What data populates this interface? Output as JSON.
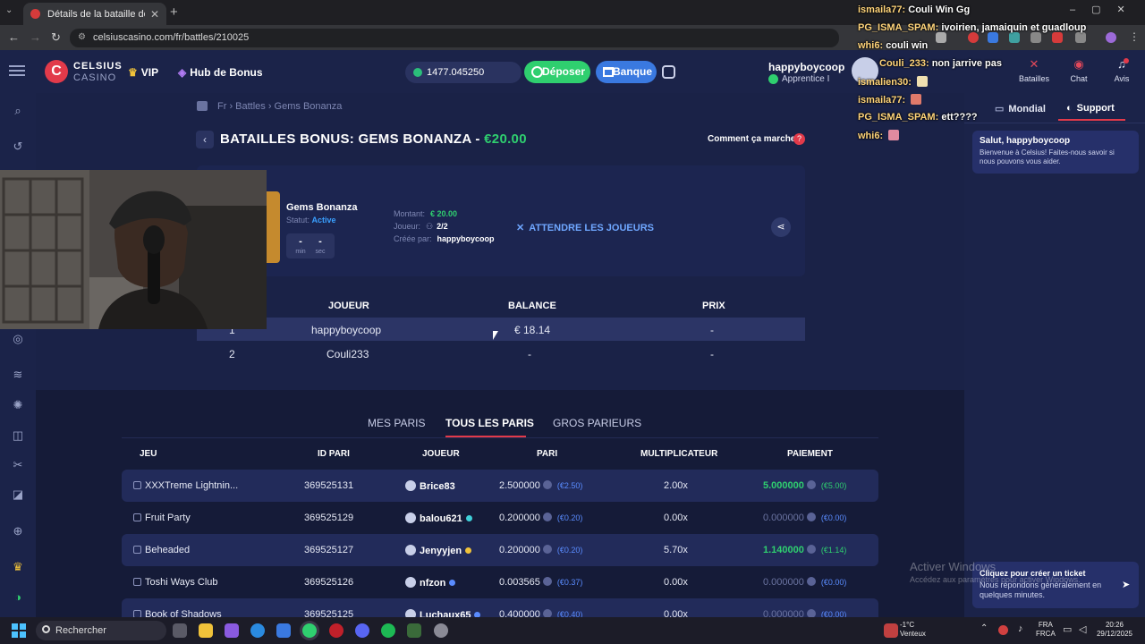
{
  "browser": {
    "tab_title": "Détails de la bataille de jeu Bat",
    "url": "celsiuscasino.com/fr/battles/210025"
  },
  "header": {
    "brand_line1": "CELSIUS",
    "brand_line2": "CASINO",
    "vip_label": "VIP",
    "hub_label": "Hub de Bonus",
    "balance": "1477.045250",
    "deposit_label": "Déposer",
    "bank_label": "Banque",
    "username": "happyboycoop",
    "rank": "Apprentice I",
    "buttons": [
      {
        "label": "Batailles",
        "icon": "swords-icon"
      },
      {
        "label": "Chat",
        "icon": "chat-icon"
      },
      {
        "label": "Avis",
        "icon": "bell-icon"
      }
    ]
  },
  "breadcrumb": {
    "text": "Fr  ›  Battles  ›  Gems Bonanza"
  },
  "page": {
    "title_prefix": "BATAILLES BONUS: GEMS BONANZA - ",
    "title_amount": "€20.00",
    "how_it_works": "Comment ça marche",
    "help_glyph": "?"
  },
  "battle": {
    "game_name": "Gems Bonanza",
    "status_label": "Statut:",
    "status_value": "Active",
    "timer": {
      "min_value": "-",
      "min_label": "min",
      "sec_value": "-",
      "sec_label": "sec"
    },
    "amount_label": "Montant:",
    "amount_value": "€ 20.00",
    "players_label": "Joueur:",
    "players_value": "2/2",
    "created_label": "Créée par:",
    "created_value": "happyboycoop",
    "waiting_label": "ATTENDRE LES JOUEURS"
  },
  "players_table": {
    "headers": [
      "JOUEUR",
      "BALANCE",
      "PRIX"
    ],
    "rows": [
      {
        "rank": "1",
        "player": "happyboycoop",
        "balance": "€ 18.14",
        "prize": "-"
      },
      {
        "rank": "2",
        "player": "Couli233",
        "balance": "-",
        "prize": "-"
      }
    ]
  },
  "bets": {
    "tabs": [
      "MES PARIS",
      "TOUS LES PARIS",
      "GROS PARIEURS"
    ],
    "active_tab": "TOUS LES PARIS",
    "headers": [
      "JEU",
      "ID PARI",
      "JOUEUR",
      "PARI",
      "MULTIPLICATEUR",
      "PAIEMENT"
    ],
    "rows": [
      {
        "game": "XXXTreme Lightnin...",
        "id": "369525131",
        "player": "Brice83",
        "tier": "",
        "bet": "2.500000",
        "bet_eur": "(€2.50)",
        "mult": "2.00x",
        "payout": "5.000000",
        "payout_eur": "(€5.00)",
        "win": true
      },
      {
        "game": "Fruit Party",
        "id": "369525129",
        "player": "balou621",
        "tier": "#3fd0d9",
        "bet": "0.200000",
        "bet_eur": "(€0.20)",
        "mult": "0.00x",
        "payout": "0.000000",
        "payout_eur": "(€0.00)",
        "win": false
      },
      {
        "game": "Beheaded",
        "id": "369525127",
        "player": "Jenyyjen",
        "tier": "#f0c23a",
        "bet": "0.200000",
        "bet_eur": "(€0.20)",
        "mult": "5.70x",
        "payout": "1.140000",
        "payout_eur": "(€1.14)",
        "win": true
      },
      {
        "game": "Toshi Ways Club",
        "id": "369525126",
        "player": "nfzon",
        "tier": "#5a8cff",
        "bet": "0.003565",
        "bet_eur": "(€0.37)",
        "mult": "0.00x",
        "payout": "0.000000",
        "payout_eur": "(€0.00)",
        "win": false
      },
      {
        "game": "Book of Shadows",
        "id": "369525125",
        "player": "Luchaux65",
        "tier": "#5a8cff",
        "bet": "0.400000",
        "bet_eur": "(€0.40)",
        "mult": "0.00x",
        "payout": "0.000000",
        "payout_eur": "(€0.00)",
        "win": false
      }
    ]
  },
  "right_panel": {
    "tabs": [
      "Mondial",
      "Support"
    ],
    "active_tab": "Support",
    "welcome_title": "Salut, happyboycoop",
    "welcome_text": "Bienvenue à Celsius! Faites-nous savoir si nous pouvons vous aider.",
    "ticket_title": "Cliquez pour créer un ticket",
    "ticket_text": "Nous répondons généralement en quelques minutes."
  },
  "windows_watermark": {
    "line1": "Activer Windows",
    "line2": "Accédez aux paramètres pour activer Windows."
  },
  "stream_chat": [
    {
      "user": "ismaila77:",
      "msg": "Couli Win Gg"
    },
    {
      "user": "PG_ISMA_SPAM:",
      "msg": "ivoirien, jamaiquin et guadloup"
    },
    {
      "user": "whi6:",
      "msg": "couli win"
    },
    {
      "user": "Couli_233:",
      "msg": "non jarrive pas"
    },
    {
      "user": "ismalien30:",
      "msg": ""
    },
    {
      "user": "ismaila77:",
      "msg": ""
    },
    {
      "user": "PG_ISMA_SPAM:",
      "msg": "ett????"
    },
    {
      "user": "whi6:",
      "msg": ""
    }
  ],
  "taskbar": {
    "search_placeholder": "Rechercher",
    "weather_temp": "-1°C",
    "weather_desc": "Venteux",
    "lang1": "FRA",
    "lang2": "FRCA",
    "time": "20:26",
    "date": "29/12/2025"
  }
}
